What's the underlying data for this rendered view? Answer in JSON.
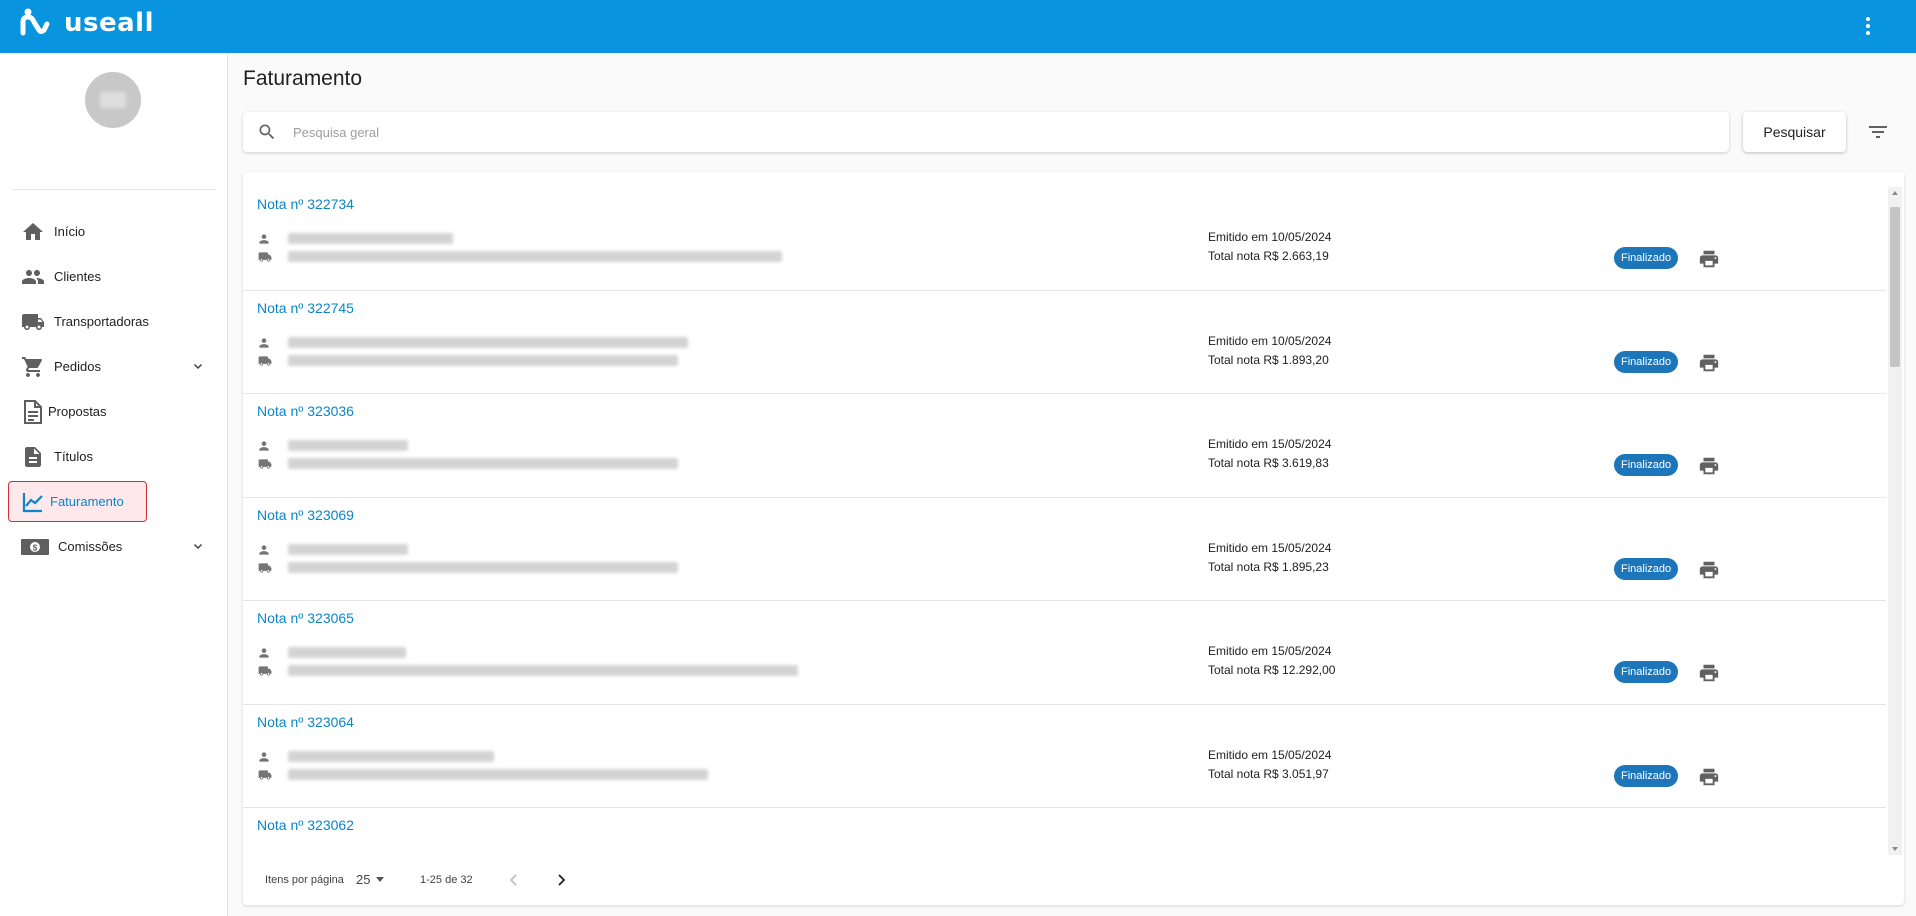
{
  "app": {
    "brand": "useall",
    "accent_color": "#0894de",
    "menu_icon": "more-vert-icon"
  },
  "sidebar": {
    "items": [
      {
        "label": "Início",
        "icon": "home-icon"
      },
      {
        "label": "Clientes",
        "icon": "people-icon"
      },
      {
        "label": "Transportadoras",
        "icon": "truck-icon"
      },
      {
        "label": "Pedidos",
        "icon": "cart-icon",
        "expandable": true
      },
      {
        "label": "Propostas",
        "icon": "document-icon"
      },
      {
        "label": "Títulos",
        "icon": "description-icon"
      },
      {
        "label": "Faturamento",
        "icon": "chart-line-icon",
        "active": true
      },
      {
        "label": "Comissões",
        "icon": "money-icon",
        "expandable": true
      }
    ]
  },
  "main": {
    "title": "Faturamento",
    "search": {
      "placeholder": "Pesquisa geral",
      "value": ""
    },
    "search_button": "Pesquisar",
    "filter_icon": "filter-list-icon"
  },
  "invoices": [
    {
      "nota": "Nota nº 322734",
      "emitido": "Emitido em 10/05/2024",
      "total": "Total nota R$ 2.663,19",
      "status": "Finalizado"
    },
    {
      "nota": "Nota nº 322745",
      "emitido": "Emitido em 10/05/2024",
      "total": "Total nota R$ 1.893,20",
      "status": "Finalizado"
    },
    {
      "nota": "Nota nº 323036",
      "emitido": "Emitido em 15/05/2024",
      "total": "Total nota R$ 3.619,83",
      "status": "Finalizado"
    },
    {
      "nota": "Nota nº 323069",
      "emitido": "Emitido em 15/05/2024",
      "total": "Total nota R$ 1.895,23",
      "status": "Finalizado"
    },
    {
      "nota": "Nota nº 323065",
      "emitido": "Emitido em 15/05/2024",
      "total": "Total nota R$ 12.292,00",
      "status": "Finalizado"
    },
    {
      "nota": "Nota nº 323064",
      "emitido": "Emitido em 15/05/2024",
      "total": "Total nota R$ 3.051,97",
      "status": "Finalizado"
    },
    {
      "nota": "Nota nº 323062"
    }
  ],
  "pagination": {
    "items_per_page_label": "Itens por página",
    "items_per_page": "25",
    "range": "1-25 de 32"
  },
  "colors": {
    "status_badge": "#1d76b9",
    "link": "#0a86c8"
  }
}
